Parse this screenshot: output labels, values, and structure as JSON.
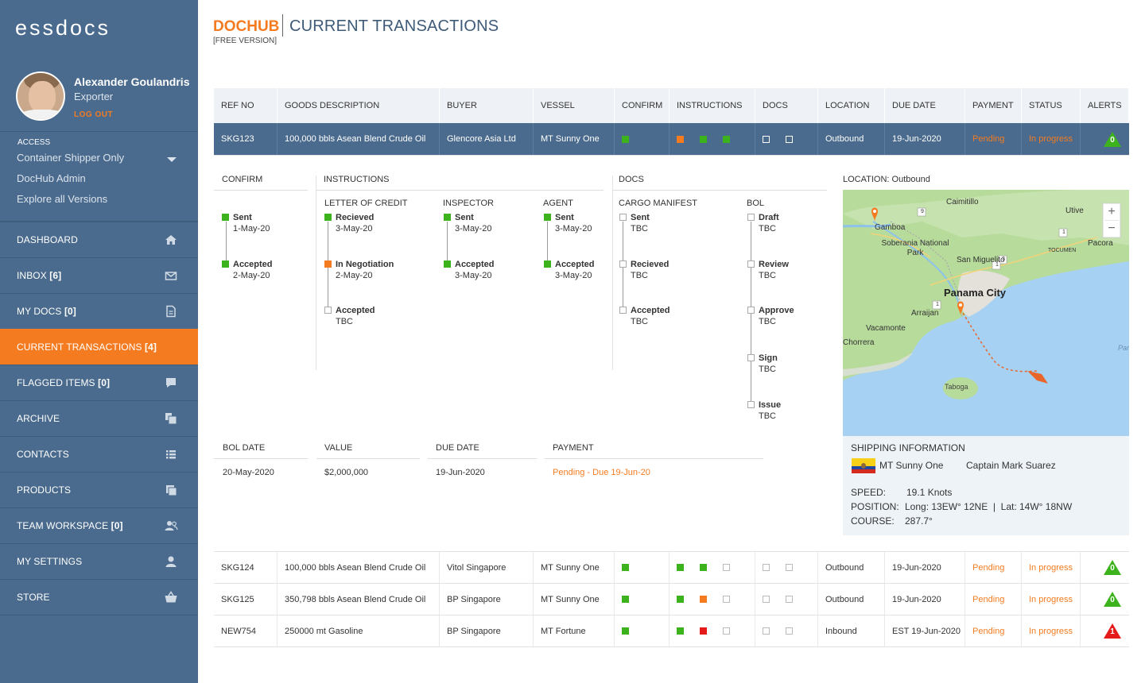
{
  "brand": {
    "logo": "essdocs"
  },
  "user": {
    "name": "Alexander Goulandris",
    "role": "Exporter",
    "logout": "LOG OUT"
  },
  "access": {
    "label": "ACCESS",
    "selected": "Container Shipper Only",
    "links": [
      "DocHub Admin",
      "Explore all Versions"
    ]
  },
  "nav": [
    {
      "label": "DASHBOARD",
      "count": "",
      "icon": "home-icon",
      "active": false
    },
    {
      "label": "INBOX",
      "count": "[6]",
      "icon": "mail-icon",
      "active": false
    },
    {
      "label": "MY DOCS",
      "count": "[0]",
      "icon": "document-icon",
      "active": false
    },
    {
      "label": "CURRENT TRANSACTIONS",
      "count": "[4]",
      "icon": "",
      "active": true
    },
    {
      "label": "FLAGGED ITEMS",
      "count": "[0]",
      "icon": "chat-icon",
      "active": false
    },
    {
      "label": "ARCHIVE",
      "count": "",
      "icon": "archive-icon",
      "active": false
    },
    {
      "label": "CONTACTS",
      "count": "",
      "icon": "list-icon",
      "active": false
    },
    {
      "label": "PRODUCTS",
      "count": "",
      "icon": "stack-icon",
      "active": false
    },
    {
      "label": "TEAM WORKSPACE",
      "count": "[0]",
      "icon": "team-icon",
      "active": false
    },
    {
      "label": "MY SETTINGS",
      "count": "",
      "icon": "user-icon",
      "active": false
    },
    {
      "label": "STORE",
      "count": "",
      "icon": "basket-icon",
      "active": false
    }
  ],
  "header": {
    "product": "DOCHUB",
    "title": "CURRENT TRANSACTIONS",
    "edition": "[FREE VERSION]"
  },
  "table": {
    "columns": [
      "REF NO",
      "GOODS DESCRIPTION",
      "BUYER",
      "VESSEL",
      "CONFIRM",
      "INSTRUCTIONS",
      "DOCS",
      "LOCATION",
      "DUE DATE",
      "PAYMENT",
      "STATUS",
      "ALERTS"
    ],
    "rows": [
      {
        "ref": "SKG123",
        "goods": "100,000 bbls Asean Blend Crude Oil",
        "buyer": "Glencore Asia Ltd",
        "vessel": "MT Sunny One",
        "confirm": [
          "green"
        ],
        "instructions": [
          "orange",
          "green",
          "green"
        ],
        "docs": [
          "empty",
          "empty"
        ],
        "location": "Outbound",
        "due": "19-Jun-2020",
        "payment": "Pending",
        "status": "In progress",
        "alert": "0",
        "alert_color": "green"
      },
      {
        "ref": "SKG124",
        "goods": "100,000 bbls Asean Blend Crude Oil",
        "buyer": "Vitol Singapore",
        "vessel": "MT Sunny One",
        "confirm": [
          "green"
        ],
        "instructions": [
          "green",
          "green",
          "empty"
        ],
        "docs": [
          "empty",
          "empty"
        ],
        "location": "Outbound",
        "due": "19-Jun-2020",
        "payment": "Pending",
        "status": "In progress",
        "alert": "0",
        "alert_color": "green"
      },
      {
        "ref": "SKG125",
        "goods": "350,798 bbls Asean Blend Crude Oil",
        "buyer": "BP Singapore",
        "vessel": "MT Sunny One",
        "confirm": [
          "green"
        ],
        "instructions": [
          "green",
          "orange",
          "empty"
        ],
        "docs": [
          "empty",
          "empty"
        ],
        "location": "Outbound",
        "due": "19-Jun-2020",
        "payment": "Pending",
        "status": "In progress",
        "alert": "0",
        "alert_color": "green"
      },
      {
        "ref": "NEW754",
        "goods": "250000 mt Gasoline",
        "buyer": "BP Singapore",
        "vessel": "MT Fortune",
        "confirm": [
          "green"
        ],
        "instructions": [
          "green",
          "red",
          "empty"
        ],
        "docs": [
          "empty",
          "empty"
        ],
        "location": "Inbound",
        "due": "EST 19-Jun-2020",
        "payment": "Pending",
        "status": "In progress",
        "alert": "1",
        "alert_color": "red"
      }
    ]
  },
  "detail": {
    "confirm": {
      "heading": "CONFIRM",
      "steps": [
        {
          "label": "Sent",
          "date": "1-May-20",
          "state": "green"
        },
        {
          "label": "Accepted",
          "date": "2-May-20",
          "state": "green"
        }
      ]
    },
    "instructions": {
      "heading": "INSTRUCTIONS",
      "groups": [
        {
          "heading": "LETTER OF CREDIT",
          "steps": [
            {
              "label": "Recieved",
              "date": "3-May-20",
              "state": "green"
            },
            {
              "label": "In Negotiation",
              "date": "2-May-20",
              "state": "orange"
            },
            {
              "label": "Accepted",
              "date": "TBC",
              "state": "empty"
            }
          ]
        },
        {
          "heading": "INSPECTOR",
          "steps": [
            {
              "label": "Sent",
              "date": "3-May-20",
              "state": "green"
            },
            {
              "label": "Accepted",
              "date": "3-May-20",
              "state": "green"
            }
          ]
        },
        {
          "heading": "AGENT",
          "steps": [
            {
              "label": "Sent",
              "date": "3-May-20",
              "state": "green"
            },
            {
              "label": "Accepted",
              "date": "3-May-20",
              "state": "green"
            }
          ]
        }
      ]
    },
    "docs": {
      "heading": "DOCS",
      "groups": [
        {
          "heading": "CARGO MANIFEST",
          "steps": [
            {
              "label": "Sent",
              "date": "TBC",
              "state": "empty"
            },
            {
              "label": "Recieved",
              "date": "TBC",
              "state": "empty"
            },
            {
              "label": "Accepted",
              "date": "TBC",
              "state": "empty"
            }
          ]
        },
        {
          "heading": "BOL",
          "steps": [
            {
              "label": "Draft",
              "date": "TBC",
              "state": "empty"
            },
            {
              "label": "Review",
              "date": "TBC",
              "state": "empty"
            },
            {
              "label": "Approve",
              "date": "TBC",
              "state": "empty"
            },
            {
              "label": "Sign",
              "date": "TBC",
              "state": "empty"
            },
            {
              "label": "Issue",
              "date": "TBC",
              "state": "empty"
            }
          ]
        }
      ]
    },
    "location": {
      "heading": "LOCATION: Outbound"
    },
    "meta": {
      "bol_date": {
        "label": "BOL DATE",
        "value": "20-May-2020"
      },
      "value": {
        "label": "VALUE",
        "value": "$2,000,000"
      },
      "due_date": {
        "label": "DUE DATE",
        "value": "19-Jun-2020"
      },
      "payment": {
        "label": "PAYMENT",
        "value": "Pending - Due 19-Jun-20"
      }
    },
    "map": {
      "zoom_in": "+",
      "zoom_out": "−",
      "places": [
        "Gamboa",
        "Caimitillo",
        "Utive",
        "Pacora",
        "Soberania National Park",
        "San Miguelito",
        "TOCUMEN",
        "Panama City",
        "Arraijan",
        "Vacamonte",
        "Chorrera",
        "Taboga",
        "Par"
      ],
      "road_numbers": [
        "9",
        "3",
        "1",
        "1",
        "1"
      ]
    },
    "shipping": {
      "heading": "SHIPPING INFORMATION",
      "vessel": "MT Sunny One",
      "captain": "Captain Mark Suarez",
      "speed_label": "SPEED:",
      "speed": "19.1 Knots",
      "position_label": "POSITION:",
      "position": "Long: 13EW° 12NE  |  Lat: 14W° 18NW",
      "course_label": "COURSE:",
      "course": "287.7°"
    }
  },
  "colors": {
    "sidebar": "#4a6b8d",
    "accent": "#f47b20",
    "ok": "#3cb21c",
    "danger": "#e51b1b",
    "title": "#3d5a78"
  }
}
